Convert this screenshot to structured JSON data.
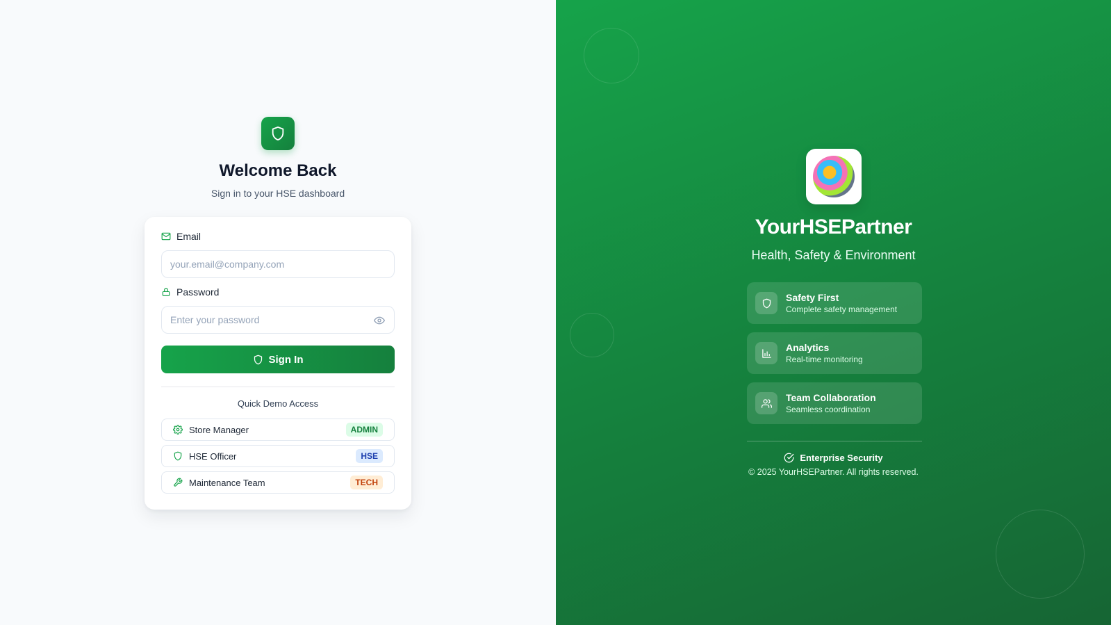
{
  "login": {
    "title": "Welcome Back",
    "subtitle": "Sign in to your HSE dashboard",
    "email_label": "Email",
    "email_placeholder": "your.email@company.com",
    "email_value": "",
    "password_label": "Password",
    "password_placeholder": "Enter your password",
    "password_value": "",
    "signin_label": "Sign In",
    "quick_demo_label": "Quick Demo Access",
    "demo_accounts": [
      {
        "name": "Store Manager",
        "badge": "ADMIN",
        "icon": "gear-icon"
      },
      {
        "name": "HSE Officer",
        "badge": "HSE",
        "icon": "shield-icon"
      },
      {
        "name": "Maintenance Team",
        "badge": "TECH",
        "icon": "wrench-icon"
      }
    ]
  },
  "brand": {
    "name": "YourHSEPartner",
    "tagline": "Health, Safety & Environment",
    "features": [
      {
        "title": "Safety First",
        "desc": "Complete safety management",
        "icon": "shield-icon"
      },
      {
        "title": "Analytics",
        "desc": "Real-time monitoring",
        "icon": "bar-chart-icon"
      },
      {
        "title": "Team Collaboration",
        "desc": "Seamless coordination",
        "icon": "users-icon"
      }
    ],
    "security_label": "Enterprise Security",
    "copyright": "© 2025 YourHSEPartner. All rights reserved."
  },
  "colors": {
    "primary": "#16a34a",
    "primary_dark": "#15803d",
    "left_bg": "#f8fafc"
  }
}
